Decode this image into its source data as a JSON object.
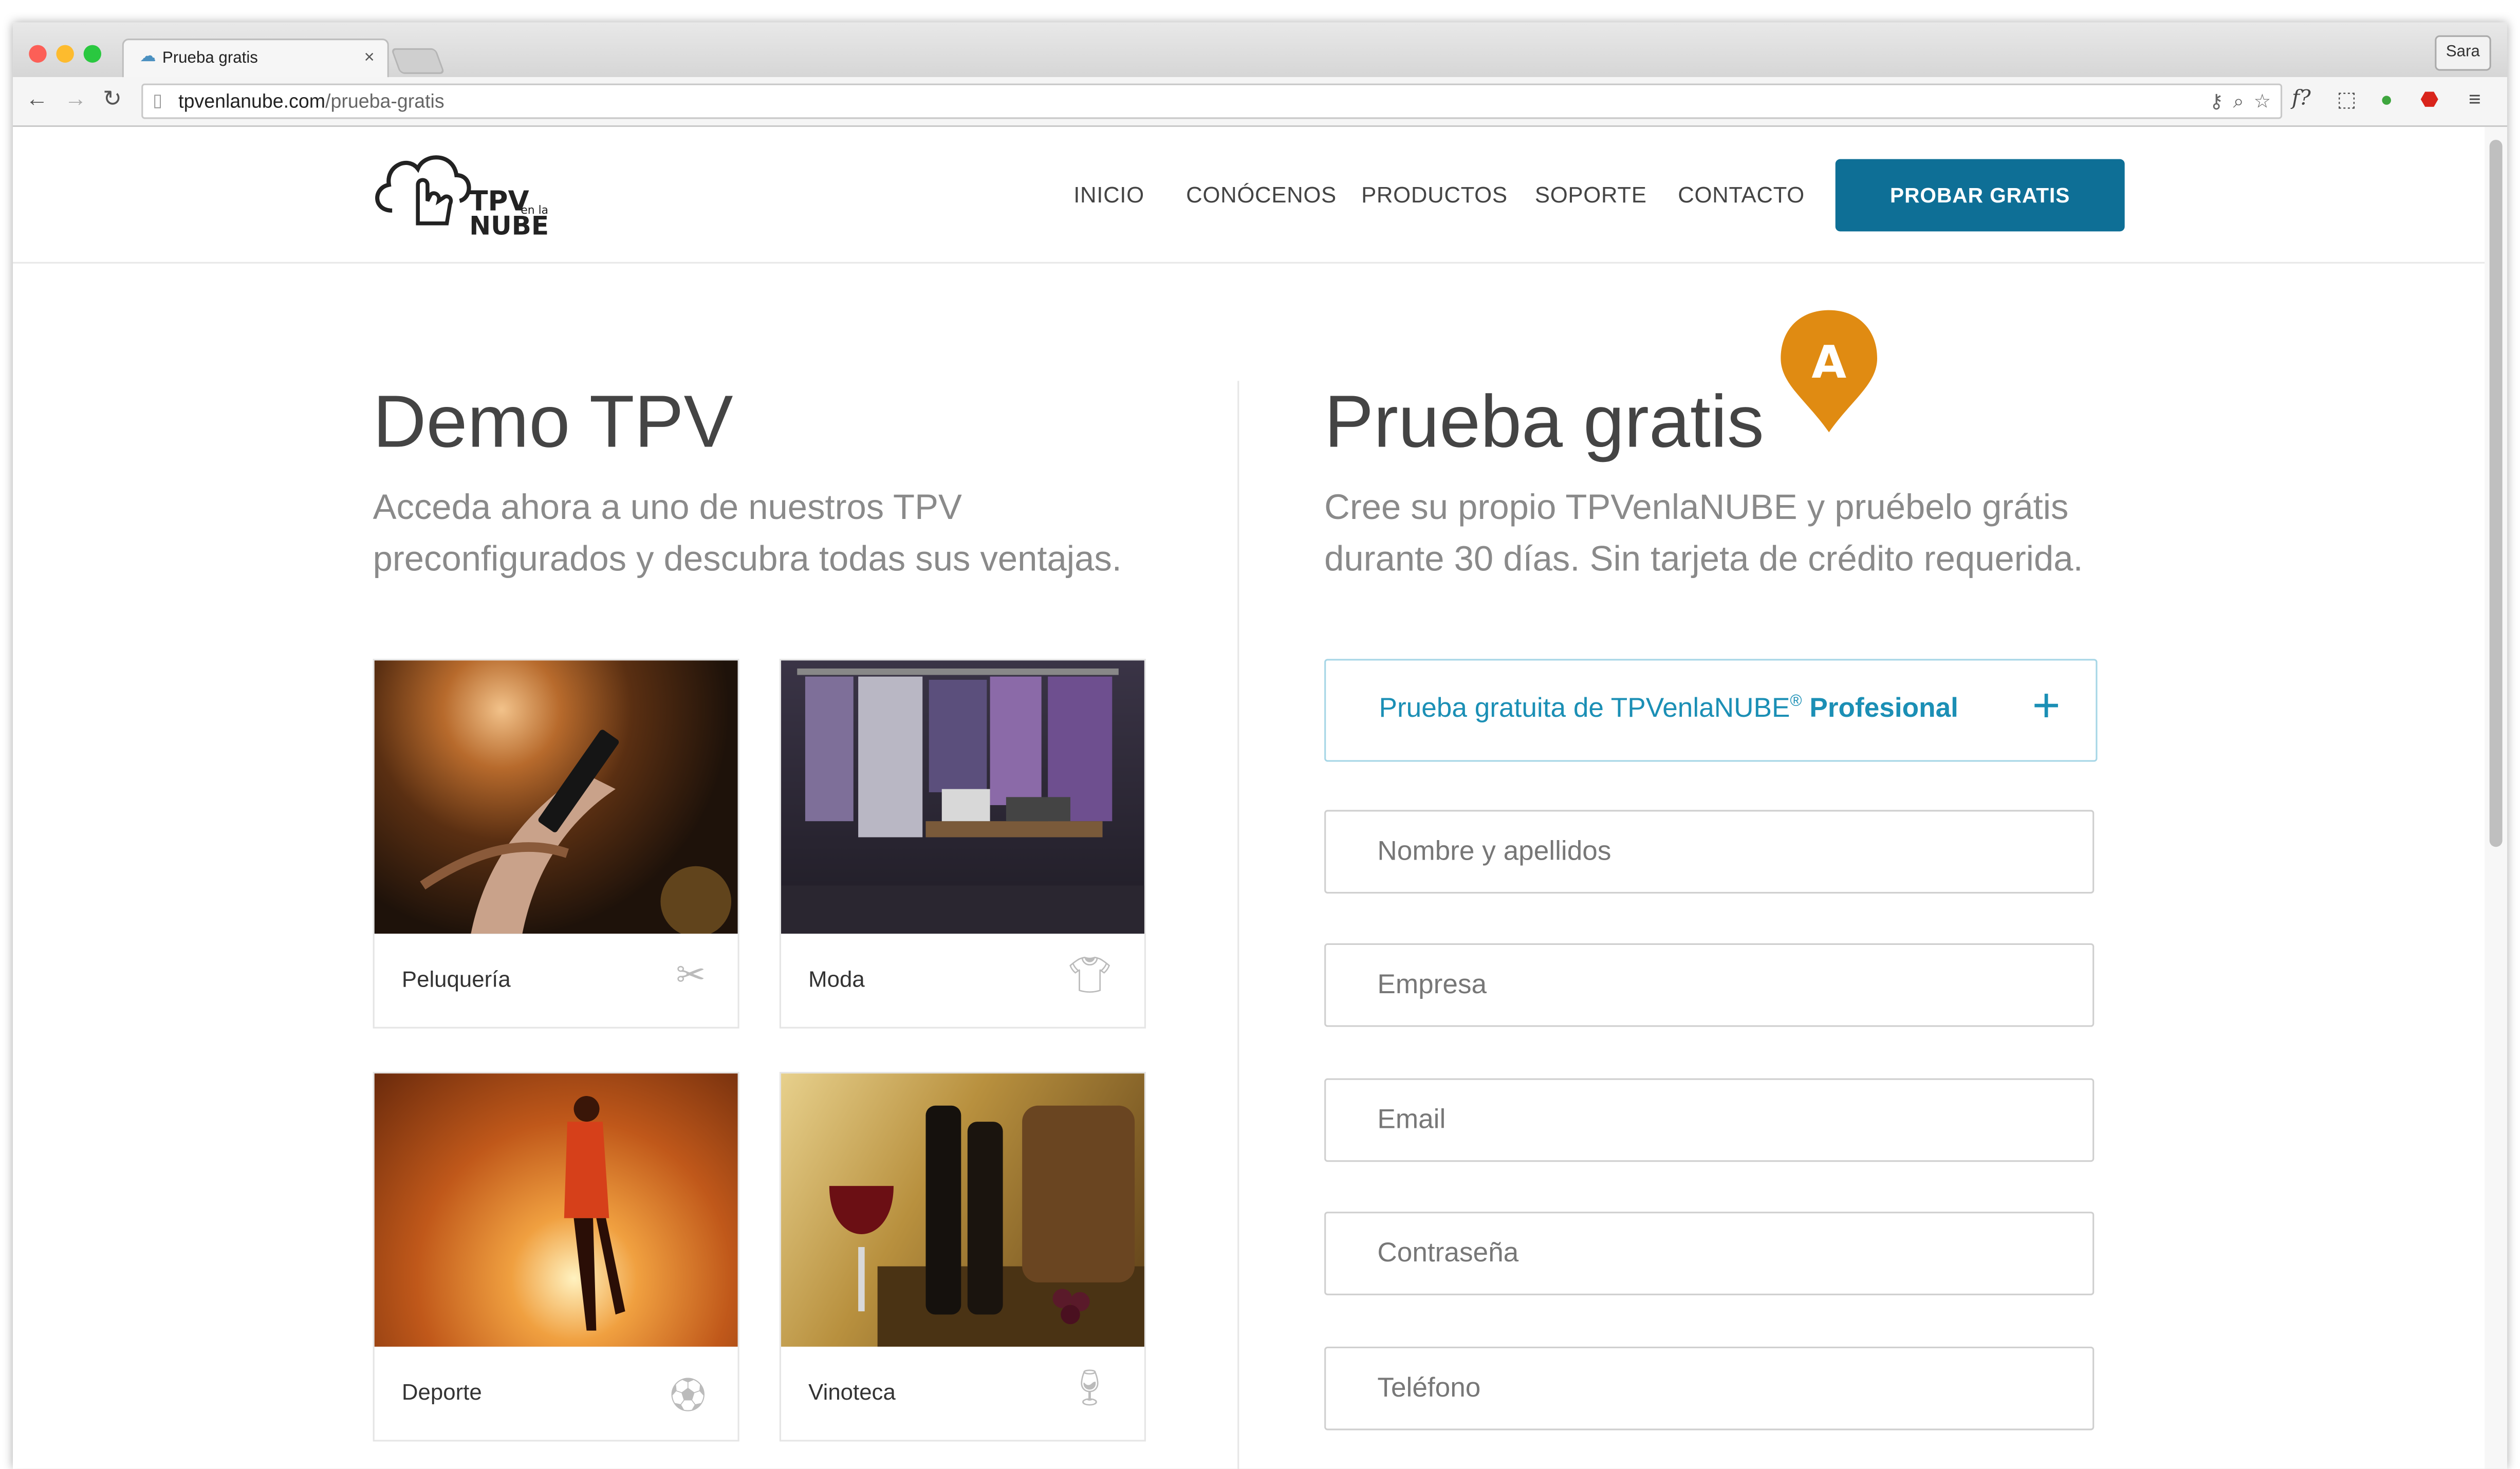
{
  "browser": {
    "tab_title": "Prueba gratis",
    "tab_close": "×",
    "user": "Sara",
    "url_domain": "tpvenlanube.com",
    "url_path": "/prueba-gratis"
  },
  "header": {
    "logo_line1": "TPV",
    "logo_small": "en la",
    "logo_line2": "NUBE",
    "nav": [
      "INICIO",
      "CONÓCENOS",
      "PRODUCTOS",
      "SOPORTE",
      "CONTACTO"
    ],
    "cta": "PROBAR GRATIS"
  },
  "demo": {
    "title": "Demo TPV",
    "subtitle_line1": "Acceda ahora a uno de nuestros TPV",
    "subtitle_line2": "preconfigurados y descubra todas sus ventajas.",
    "cards": [
      {
        "label": "Peluquería",
        "icon": "scissors-icon"
      },
      {
        "label": "Moda",
        "icon": "tshirt-icon"
      },
      {
        "label": "Deporte",
        "icon": "soccer-ball-icon"
      },
      {
        "label": "Vinoteca",
        "icon": "wine-glass-icon"
      }
    ]
  },
  "trial": {
    "title": "Prueba gratis",
    "marker": "A",
    "subtitle_line1": "Cree su propio TPVenlaNUBE y pruébelo grátis",
    "subtitle_line2": "durante 30 días. Sin tarjeta de crédito requerida.",
    "plan_prefix": "Prueba gratuita de TPVenlaNUBE",
    "plan_reg": "®",
    "plan_name": "Profesional",
    "plan_toggle": "+",
    "fields": {
      "name": "Nombre y apellidos",
      "company": "Empresa",
      "email": "Email",
      "password": "Contraseña",
      "phone": "Teléfono"
    }
  },
  "colors": {
    "accent": "#0e6f96",
    "marker": "#e08b12",
    "plan_text": "#1b8fb5"
  }
}
